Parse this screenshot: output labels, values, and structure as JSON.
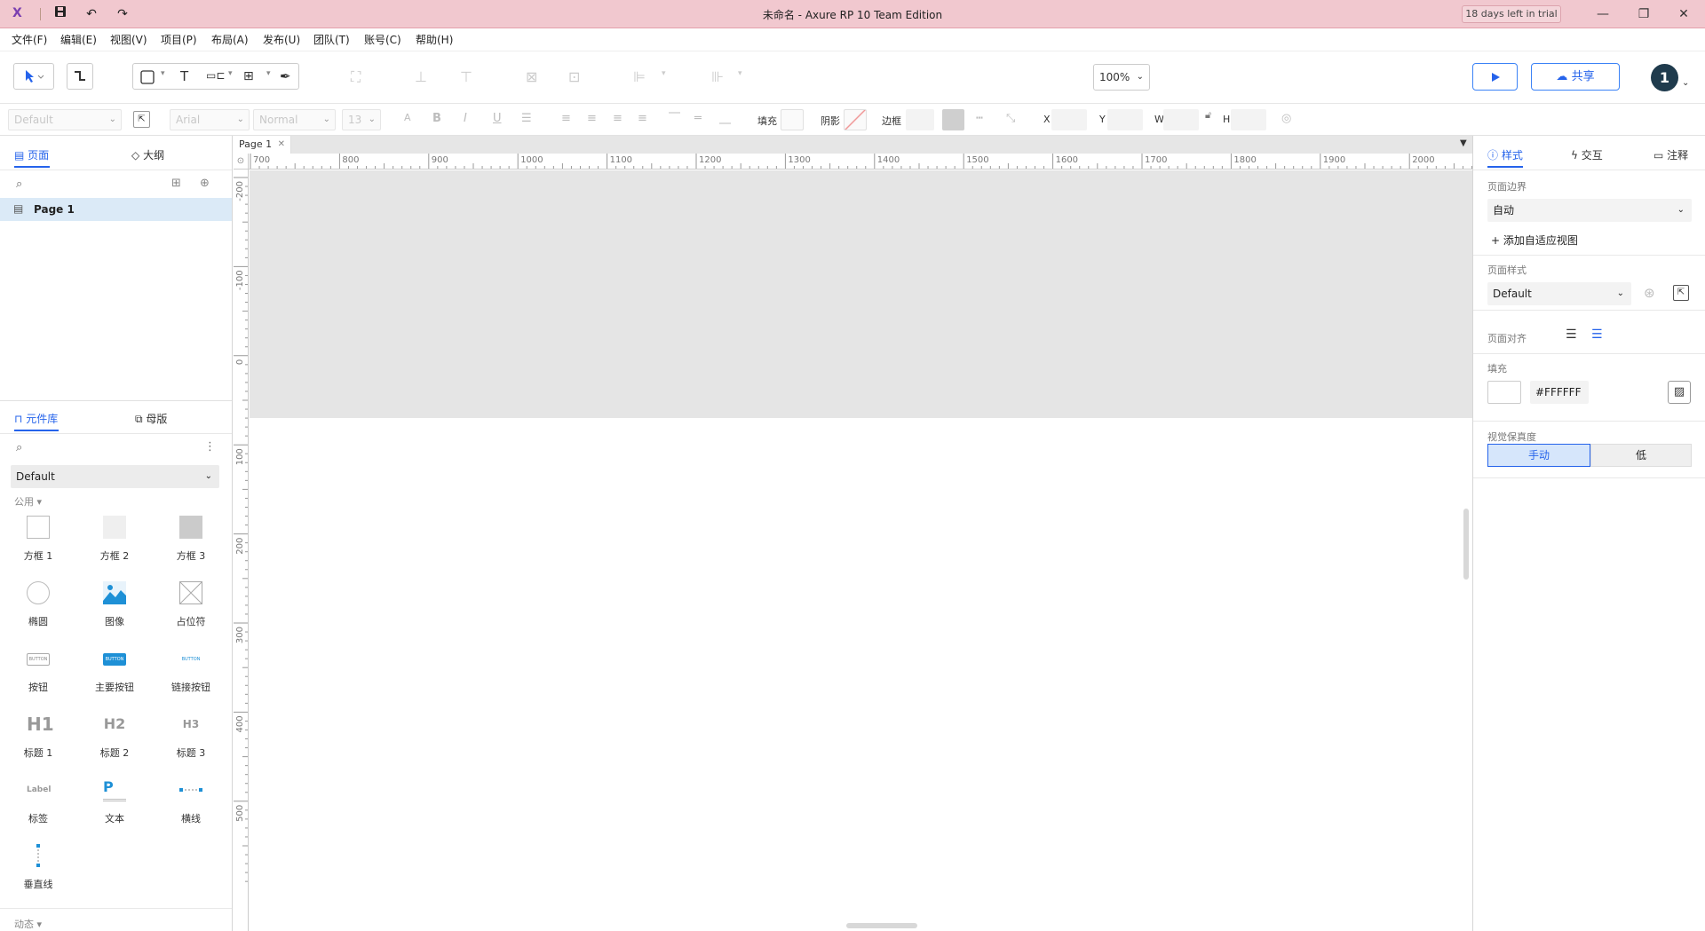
{
  "titlebar": {
    "app_title": "未命名 - Axure RP 10 Team Edition",
    "trial_badge": "18 days left in trial",
    "logo_glyph": "X"
  },
  "menu": [
    "文件(F)",
    "编辑(E)",
    "视图(V)",
    "项目(P)",
    "布局(A)",
    "发布(U)",
    "团队(T)",
    "账号(C)",
    "帮助(H)"
  ],
  "toolbar": {
    "zoom": "100%",
    "share_label": "共享",
    "avatar_text": "1"
  },
  "format_bar": {
    "style_select": "Default",
    "font_select": "Arial",
    "weight_select": "Normal",
    "size_select": "13",
    "fill_label": "填充",
    "shadow_label": "阴影",
    "border_label": "边框",
    "x_label": "X",
    "y_label": "Y",
    "w_label": "W",
    "h_label": "H"
  },
  "left_panel": {
    "tab_pages": "页面",
    "tab_outline": "大纲",
    "pages": [
      "Page 1"
    ],
    "tab_library": "元件库",
    "tab_masters": "母版",
    "library_select": "Default",
    "section_common": "公用",
    "section_dynamic": "动态",
    "widgets": [
      {
        "label": "方框 1",
        "icon": "box1-icon"
      },
      {
        "label": "方框 2",
        "icon": "box2-icon"
      },
      {
        "label": "方框 3",
        "icon": "box3-icon"
      },
      {
        "label": "椭圆",
        "icon": "ellipse-icon"
      },
      {
        "label": "图像",
        "icon": "image-icon"
      },
      {
        "label": "占位符",
        "icon": "placeholder-icon"
      },
      {
        "label": "按钮",
        "icon": "button-icon"
      },
      {
        "label": "主要按钮",
        "icon": "primary-button-icon"
      },
      {
        "label": "链接按钮",
        "icon": "link-button-icon"
      },
      {
        "label": "标题 1",
        "icon": "heading1-icon"
      },
      {
        "label": "标题 2",
        "icon": "heading2-icon"
      },
      {
        "label": "标题 3",
        "icon": "heading3-icon"
      },
      {
        "label": "标签",
        "icon": "label-icon"
      },
      {
        "label": "文本",
        "icon": "text-icon"
      },
      {
        "label": "横线",
        "icon": "hline-icon"
      },
      {
        "label": "垂直线",
        "icon": "vline-icon"
      }
    ],
    "widget_icon_text": {
      "button": "BUTTON",
      "h1": "H1",
      "h2": "H2",
      "h3": "H3",
      "label": "Label",
      "text": "P"
    }
  },
  "canvas": {
    "tab_label": "Page 1",
    "hruler_ticks": [
      "700",
      "800",
      "900",
      "1000",
      "1100",
      "1200",
      "1300",
      "1400",
      "1500",
      "1600",
      "1700",
      "1800",
      "1900",
      "2000"
    ],
    "vruler_ticks": [
      "-200",
      "-100",
      "0",
      "100",
      "200",
      "300",
      "400",
      "500"
    ]
  },
  "right_panel": {
    "tab_style": "样式",
    "tab_interact": "交互",
    "tab_notes": "注释",
    "page_bounds_label": "页面边界",
    "page_bounds_value": "自动",
    "add_adaptive_view": "+ 添加自适应视图",
    "page_style_label": "页面样式",
    "page_style_value": "Default",
    "page_align_label": "页面对齐",
    "fill_label": "填充",
    "fill_hex": "#FFFFFF",
    "visual_fidelity_label": "视觉保真度",
    "fidelity_manual": "手动",
    "fidelity_low": "低"
  },
  "colors": {
    "accent": "#2563eb",
    "titlebar_bg": "#f1c8cf",
    "selected_row": "#dbeaf7"
  }
}
